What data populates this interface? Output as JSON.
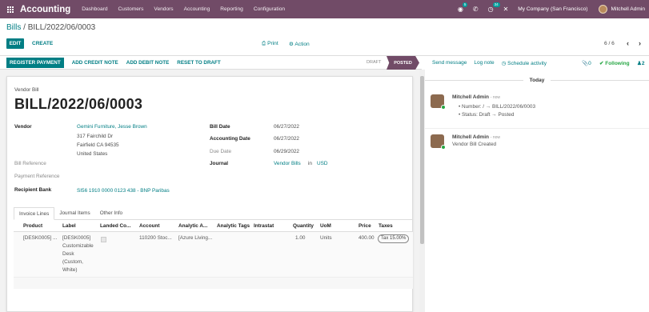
{
  "topbar": {
    "app_name": "Accounting",
    "menus": [
      "Dashboard",
      "Customers",
      "Vendors",
      "Accounting",
      "Reporting",
      "Configuration"
    ],
    "chat_badge": "5",
    "activity_badge": "34",
    "company": "My Company (San Francisco)",
    "user": "Mitchell Admin"
  },
  "control": {
    "breadcrumb_parent": "Bills",
    "breadcrumb_current": "BILL/2022/06/0003",
    "edit_label": "EDIT",
    "create_label": "CREATE",
    "print_label": "Print",
    "action_label": "Action",
    "pager": "6 / 6"
  },
  "statusbar": {
    "buttons": [
      "REGISTER PAYMENT",
      "ADD CREDIT NOTE",
      "ADD DEBIT NOTE",
      "RESET TO DRAFT"
    ],
    "stage_draft": "DRAFT",
    "stage_posted": "POSTED"
  },
  "bill": {
    "type_label": "Vendor Bill",
    "number": "BILL/2022/06/0003",
    "vendor_label": "Vendor",
    "vendor_name": "Gemini Furniture, Jesse Brown",
    "vendor_street": "317 Fairchild Dr",
    "vendor_city": "Fairfield CA 94535",
    "vendor_country": "United States",
    "bill_reference_label": "Bill Reference",
    "payment_reference_label": "Payment Reference",
    "recipient_bank_label": "Recipient Bank",
    "recipient_bank": "SI56 1910 0000 0123 438 - BNP Paribas",
    "bill_date_label": "Bill Date",
    "bill_date": "06/27/2022",
    "accounting_date_label": "Accounting Date",
    "accounting_date": "06/27/2022",
    "due_date_label": "Due Date",
    "due_date": "06/29/2022",
    "journal_label": "Journal",
    "journal": "Vendor Bills",
    "journal_in": "in",
    "currency": "USD"
  },
  "tabs": [
    "Invoice Lines",
    "Journal Items",
    "Other Info"
  ],
  "lines": {
    "columns": [
      "Product",
      "Label",
      "Landed Co...",
      "Account",
      "Analytic A...",
      "Analytic Tags",
      "Intrastat",
      "Quantity",
      "UoM",
      "Price",
      "Taxes"
    ],
    "row": {
      "product": "[DESK0005] ...",
      "label": [
        "[DESK0005]",
        "Customizable",
        "Desk",
        "(Custom,",
        "White)"
      ],
      "account": "110200 Stoc...",
      "analytic": "[Azure Living...",
      "quantity": "1.00",
      "uom": "Units",
      "price": "400.00",
      "tax": "Tax 15.00%"
    }
  },
  "chatter": {
    "send_message": "Send message",
    "log_note": "Log note",
    "schedule": "Schedule activity",
    "attachments": "0",
    "following": "Following",
    "followers": "2",
    "today": "Today",
    "messages": [
      {
        "author": "Mitchell Admin",
        "time": "now",
        "lines": [
          "Number: / → BILL/2022/06/0003",
          "Status: Draft → Posted"
        ]
      },
      {
        "author": "Mitchell Admin",
        "time": "now",
        "lines": [
          "Vendor Bill Created"
        ]
      }
    ]
  }
}
